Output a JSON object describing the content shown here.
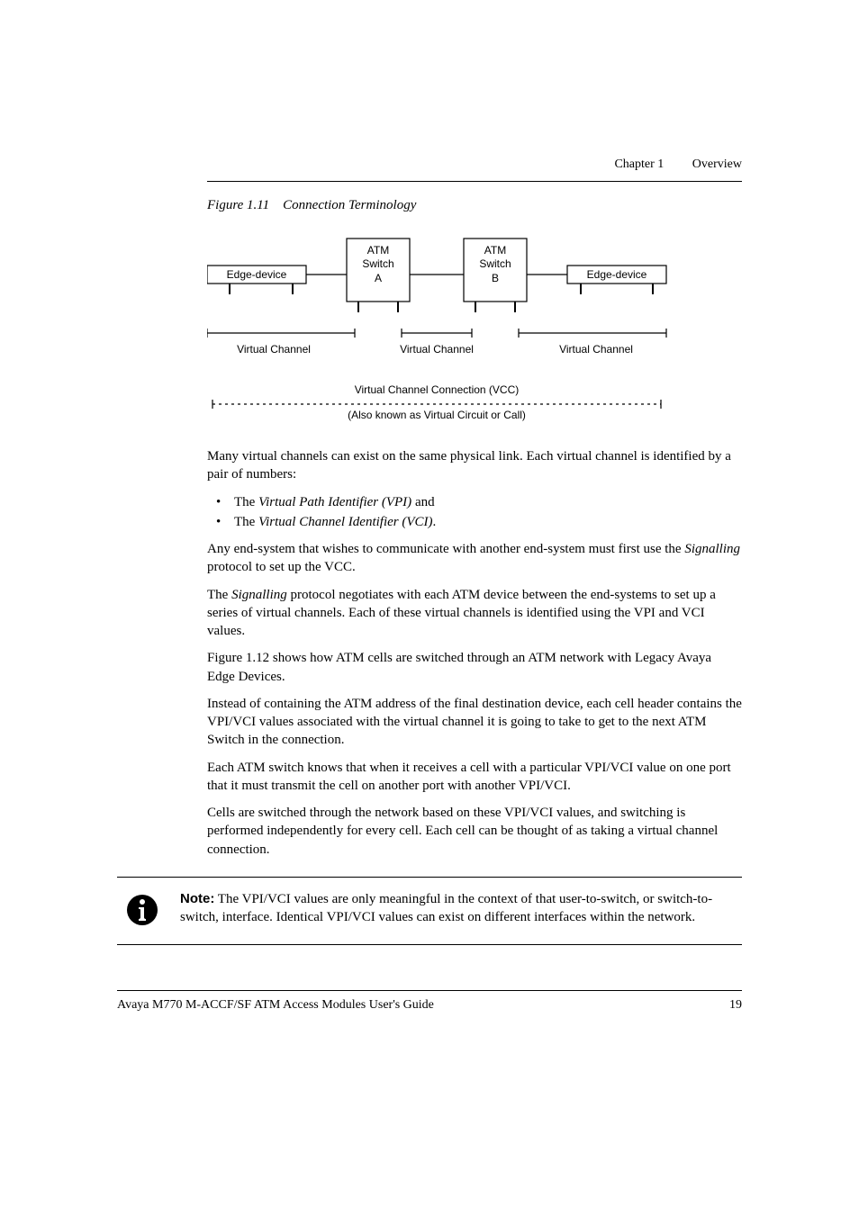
{
  "header": {
    "chapter": "Chapter 1",
    "title": "Overview"
  },
  "figure": {
    "caption_prefix": "Figure 1.11",
    "caption_title": "Connection Terminology",
    "labels": {
      "edge_left": "Edge-device",
      "edge_right": "Edge-device",
      "atm": "ATM",
      "switch": "Switch",
      "a": "A",
      "b": "B",
      "vc": "Virtual Channel",
      "vcc": "Virtual Channel Connection (VCC)",
      "vcc_sub": "(Also known as Virtual Circuit or Call)"
    }
  },
  "body": {
    "p1": "Many virtual channels can exist on the same physical link. Each virtual channel is identified by a pair of numbers:",
    "bullet1a": "The ",
    "bullet1b": "Virtual Path Identifier (VPI)",
    "bullet1c": " and",
    "bullet2a": "The ",
    "bullet2b": "Virtual Channel Identifier (VCI)",
    "bullet2c": ".",
    "p2a": "Any end-system that wishes to communicate with another end-system must first use the ",
    "p2b": "Signalling",
    "p2c": " protocol to set up the VCC.",
    "p3a": "The ",
    "p3b": "Signalling",
    "p3c": " protocol negotiates with each ATM device between the end-systems to set up a series of virtual channels. Each of these virtual channels is identified using the VPI and VCI values.",
    "p4": "Figure 1.12 shows how ATM cells are switched through an ATM network with Legacy Avaya Edge Devices.",
    "p5": "Instead of containing the ATM address of the final destination device, each cell header contains the VPI/VCI values associated with the virtual channel it is going to take to get to the next ATM Switch in the connection.",
    "p6": "Each ATM switch knows that when it receives a cell with a particular VPI/VCI value on one port that it must transmit the cell on another port with another VPI/VCI.",
    "p7": "Cells are switched through the network based on these VPI/VCI values, and switching is performed independently for every cell. Each cell can be thought of as taking a virtual channel connection."
  },
  "note": {
    "label": "Note:",
    "text": "  The VPI/VCI values are only meaningful in the context of that user-to-switch, or switch-to-switch, interface. Identical VPI/VCI values can exist on different interfaces within the network."
  },
  "footer": {
    "left": "Avaya M770 M-ACCF/SF ATM Access Modules User's Guide",
    "right": "19"
  }
}
